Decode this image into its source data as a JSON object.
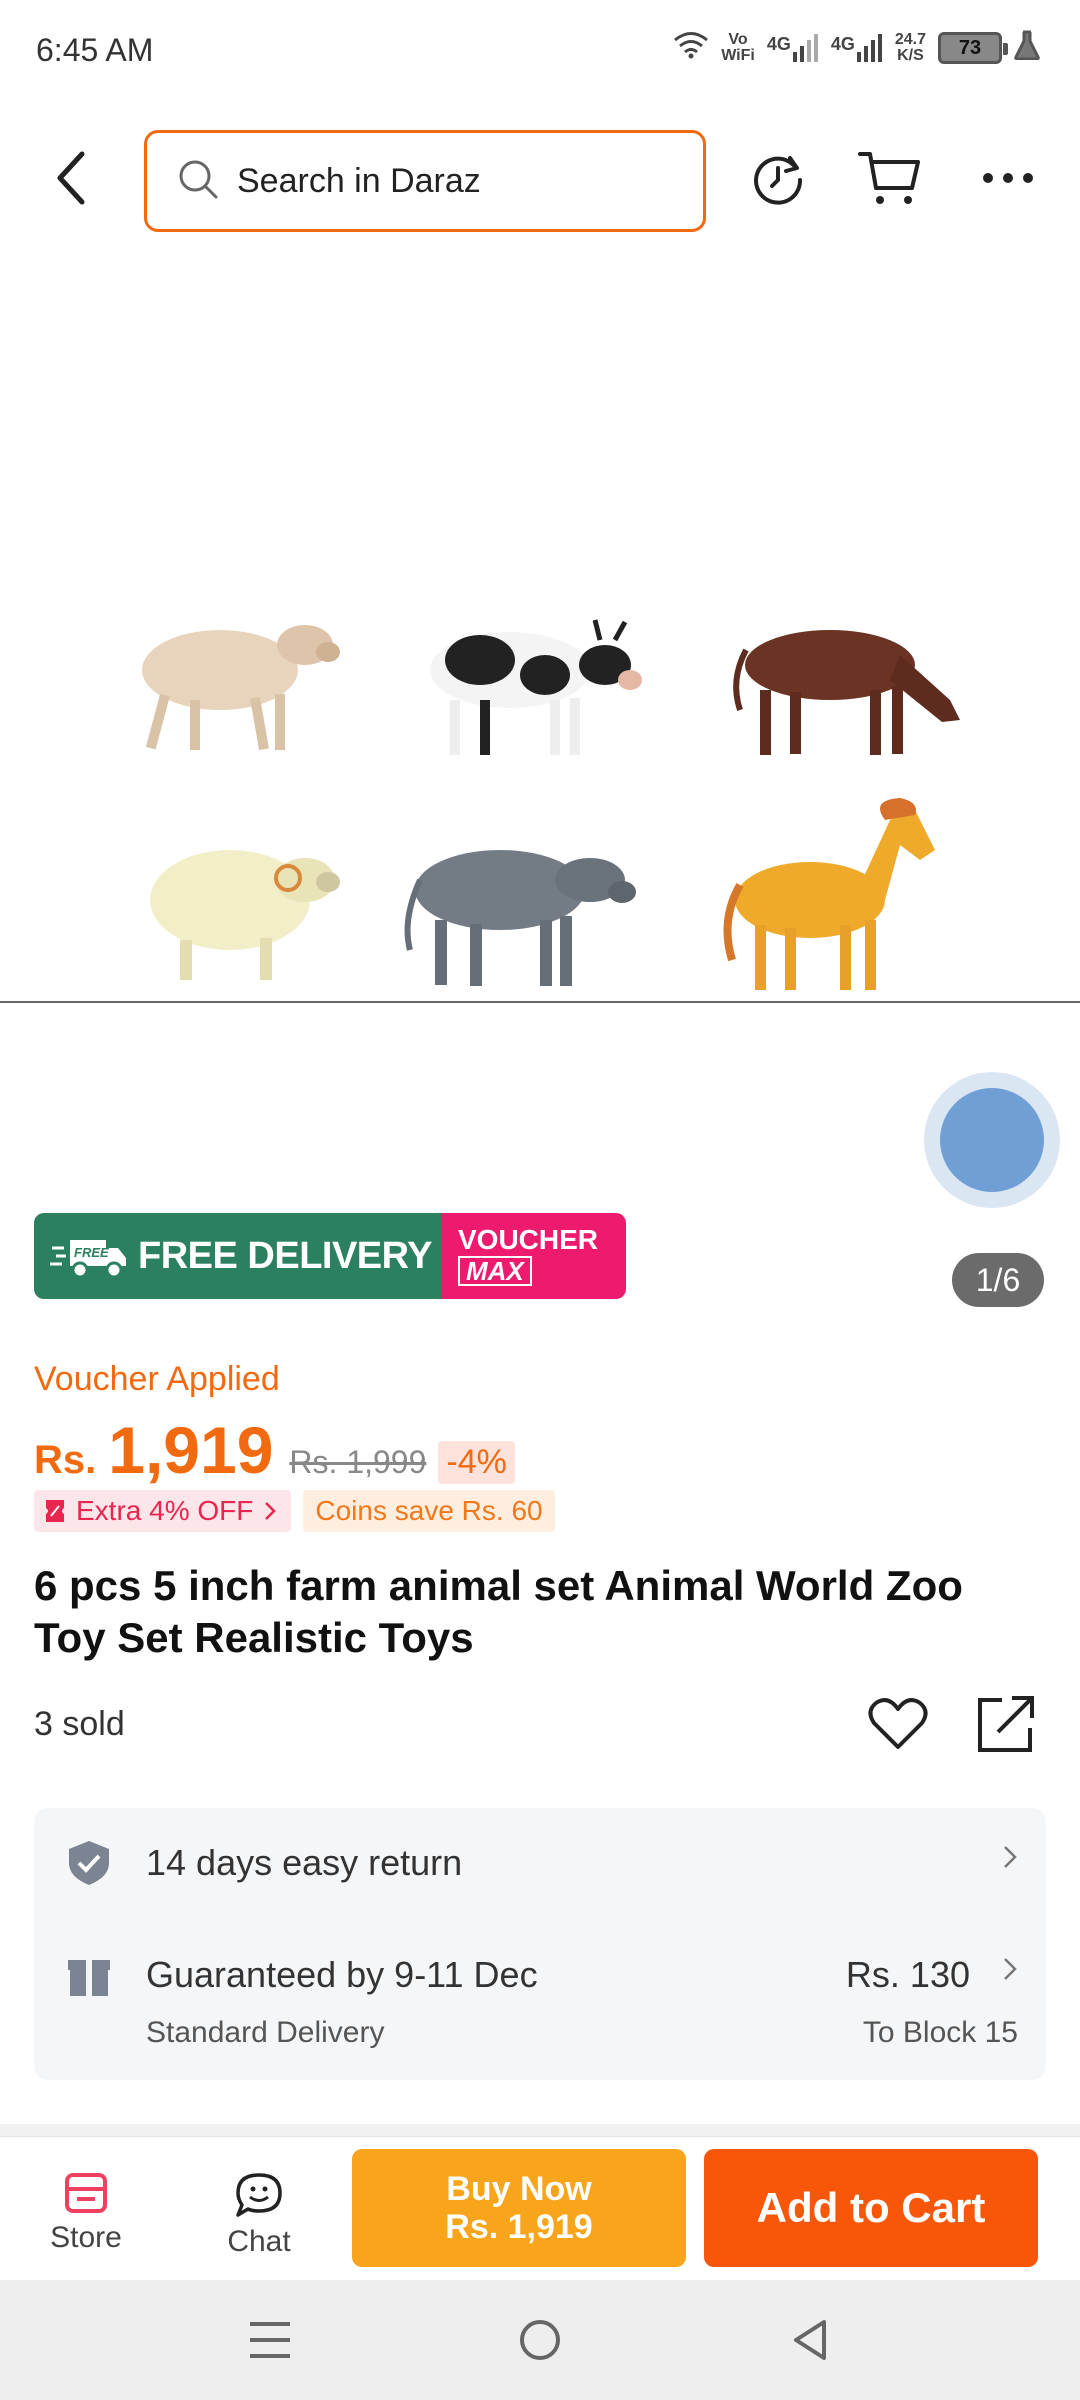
{
  "status_bar": {
    "time": "6:45 AM",
    "vowifi_top": "Vo",
    "vowifi_bottom": "WiFi",
    "net1": "4G",
    "net2": "4G",
    "speed_top": "24.7",
    "speed_bottom": "K/S",
    "battery": "73"
  },
  "search": {
    "placeholder": "Search in Daraz"
  },
  "gallery": {
    "page_indicator": "1/6"
  },
  "promo": {
    "free_tag": "FREE",
    "free_delivery": "FREE DELIVERY",
    "voucher_line1": "VOUCHER",
    "voucher_line2": "MAX"
  },
  "pricing": {
    "voucher_applied": "Voucher Applied",
    "currency": "Rs.",
    "price": "1,919",
    "original_price": "Rs. 1,999",
    "discount": "-4%",
    "extra_off": "Extra 4% OFF",
    "coins_save": "Coins save Rs. 60"
  },
  "product": {
    "title": "6 pcs 5 inch farm animal set Animal World Zoo Toy Set Realistic Toys",
    "sold": "3 sold"
  },
  "delivery": {
    "return_text": "14 days easy return",
    "guarantee_text": "Guaranteed by 9-11 Dec",
    "delivery_type": "Standard Delivery",
    "fee": "Rs. 130",
    "destination": "To Block 15"
  },
  "actions": {
    "store_label": "Store",
    "chat_label": "Chat",
    "buy_now_line1": "Buy Now",
    "buy_now_line2": "Rs. 1,919",
    "add_to_cart": "Add to Cart"
  },
  "colors": {
    "accent": "#f26a10",
    "buy_now": "#f8a51b",
    "add_to_cart": "#f8570a",
    "free_delivery": "#2b8060",
    "voucher_max": "#ee1a6e"
  }
}
